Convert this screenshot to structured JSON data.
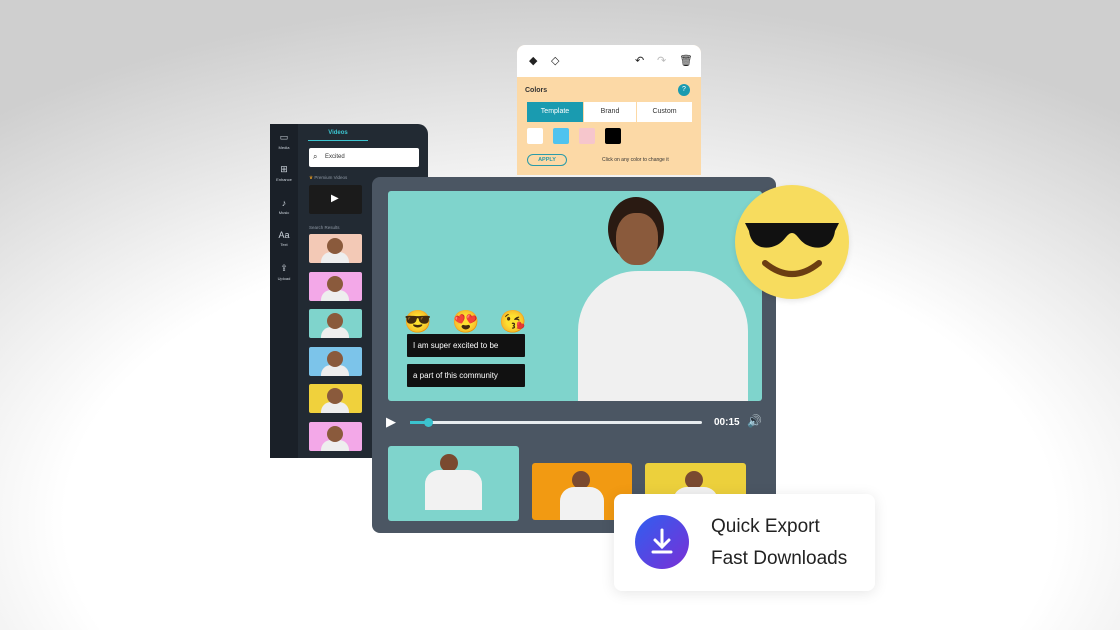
{
  "media_panel": {
    "rail": [
      {
        "icon": "folder-icon",
        "label": "Media"
      },
      {
        "icon": "enhance-icon",
        "label": "Enhance"
      },
      {
        "icon": "music-icon",
        "label": "Music"
      },
      {
        "icon": "text-icon",
        "label": "Text"
      },
      {
        "icon": "upload-icon",
        "label": "Upload"
      }
    ],
    "tab": "Videos",
    "search_value": "Excited",
    "premium_label": "Premium Videos",
    "results_label": "Search Results",
    "result_colors": [
      "#f3c9b6",
      "#f3a8e8",
      "#7fd4cc",
      "#7cc4ea",
      "#f0d13c",
      "#f3a8e8"
    ]
  },
  "colors_panel": {
    "title": "Colors",
    "help": "?",
    "tabs": [
      "Template",
      "Brand",
      "Custom"
    ],
    "active_tab": "Template",
    "swatches": [
      "#ffffff",
      "#4fc3ef",
      "#f6c6cc",
      "#000000"
    ],
    "apply_label": "APPLY",
    "hint": "Click on any color to change it"
  },
  "player": {
    "emojis": [
      "😎",
      "😍",
      "😘"
    ],
    "captions": [
      "I am super excited to be",
      "a part of this community"
    ],
    "time": "00:15",
    "progress": 0.06,
    "accent": "#3bc3cf"
  },
  "timeline_colors": [
    "#7fd4cc",
    "#f29a12",
    "#ecd03c"
  ],
  "export_card": {
    "line1": "Quick Export",
    "line2": "Fast Downloads"
  }
}
